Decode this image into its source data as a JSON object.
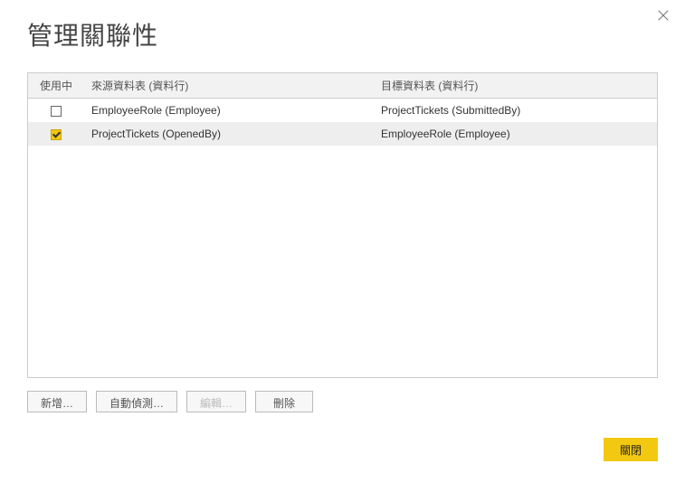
{
  "dialog": {
    "title": "管理關聯性",
    "close_icon": "close"
  },
  "table": {
    "headers": {
      "active": "使用中",
      "source": "來源資料表 (資料行)",
      "target": "目標資料表 (資料行)"
    },
    "rows": [
      {
        "active": false,
        "selected": false,
        "source": "EmployeeRole (Employee)",
        "target": "ProjectTickets (SubmittedBy)"
      },
      {
        "active": true,
        "selected": true,
        "source": "ProjectTickets (OpenedBy)",
        "target": "EmployeeRole (Employee)"
      }
    ]
  },
  "buttons": {
    "new": "新增…",
    "autodetect": "自動偵測…",
    "edit": "編輯…",
    "delete": "刪除"
  },
  "footer": {
    "close": "關閉"
  }
}
